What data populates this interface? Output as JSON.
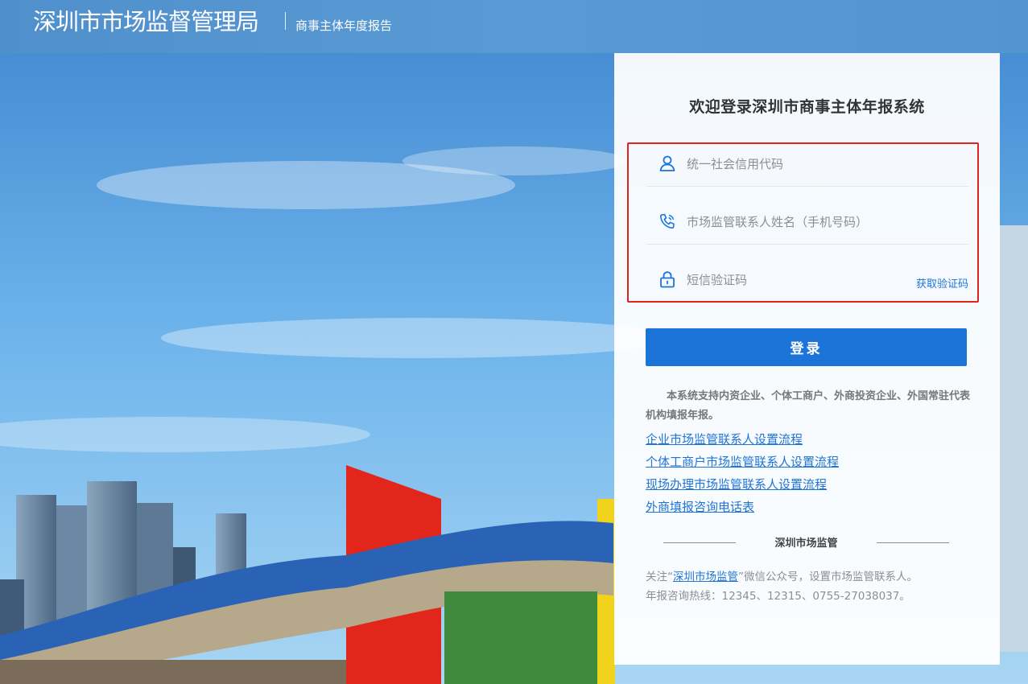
{
  "header": {
    "org_name": "深圳市市场监督管理局",
    "system_name": "商事主体年度报告"
  },
  "login": {
    "welcome": "欢迎登录深圳市商事主体年报系统",
    "fields": {
      "credit_code_placeholder": "统一社会信用代码",
      "contact_placeholder": "市场监管联系人姓名（手机号码）",
      "sms_placeholder": "短信验证码"
    },
    "get_code_label": "获取验证码",
    "submit_label": "登录"
  },
  "info": {
    "notice": "本系统支持内资企业、个体工商户、外商投资企业、外国常驻代表机构填报年报。",
    "links": [
      "企业市场监管联系人设置流程",
      "个体工商户市场监管联系人设置流程",
      "现场办理市场监管联系人设置流程",
      "外商填报咨询电话表"
    ],
    "section_title": "深圳市场监管",
    "follow_prefix": "关注“",
    "follow_link": "深圳市场监管",
    "follow_suffix": "”微信公众号，设置市场监管联系人。",
    "hotline": "年报咨询热线：12345、12315、0755-27038037。"
  },
  "colors": {
    "header_bg": "#5395d0",
    "primary": "#1d74d8",
    "link": "#1f74d6",
    "highlight_border": "#e0231f"
  },
  "icons": [
    "user-icon",
    "phone-icon",
    "lock-icon"
  ]
}
